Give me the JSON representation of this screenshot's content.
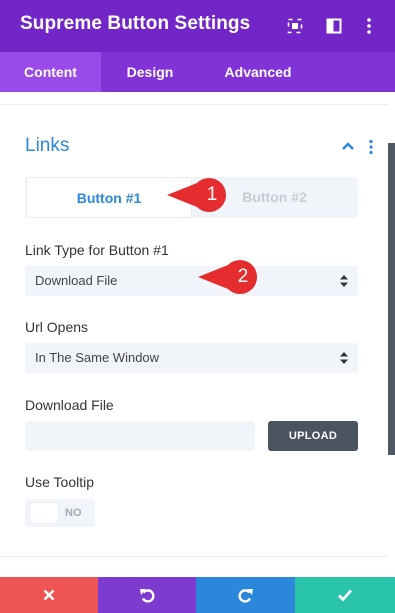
{
  "header": {
    "title": "Supreme Button Settings",
    "icons": [
      "expand-icon",
      "split-view-icon",
      "more-vertical-icon"
    ]
  },
  "tabs": [
    {
      "label": "Content",
      "active": true
    },
    {
      "label": "Design",
      "active": false
    },
    {
      "label": "Advanced",
      "active": false
    }
  ],
  "section": {
    "title": "Links",
    "toggle": {
      "options": [
        "Button #1",
        "Button #2"
      ],
      "selected": "Button #1"
    },
    "link_type": {
      "label": "Link Type for Button #1",
      "value": "Download File"
    },
    "url_opens": {
      "label": "Url Opens",
      "value": "In The Same Window"
    },
    "download_file": {
      "label": "Download File",
      "value": "",
      "upload_label": "UPLOAD"
    },
    "tooltip": {
      "label": "Use Tooltip",
      "state": "NO"
    }
  },
  "callouts": [
    "1",
    "2"
  ],
  "footer": {
    "icons": [
      "close-icon",
      "undo-icon",
      "redo-icon",
      "check-icon"
    ]
  },
  "colors": {
    "header": "#7226c7",
    "tabs": "#8233d8",
    "accent": "#2b87da",
    "callout": "#e52d30",
    "cancel": "#ef5555",
    "undo": "#7e3bd0",
    "redo": "#2b87da",
    "save": "#29c4a9"
  }
}
